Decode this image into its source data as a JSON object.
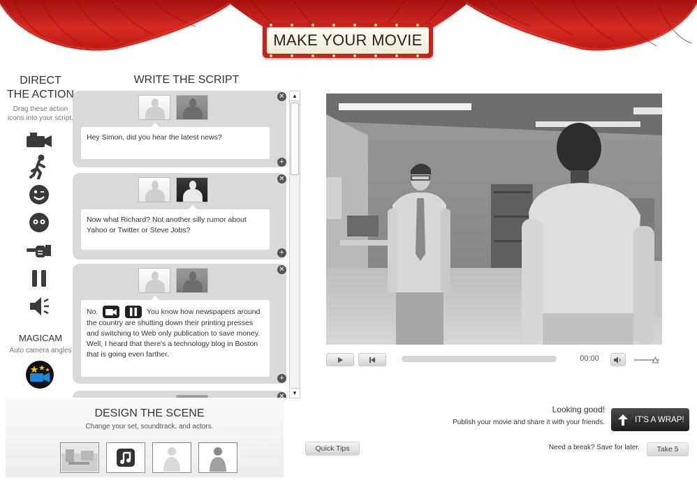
{
  "header": {
    "title": "MAKE YOUR MOVIE"
  },
  "direct": {
    "title_line1": "DIRECT",
    "title_line2": "THE ACTION",
    "subtitle_line1": "Drag these action",
    "subtitle_line2": "icons into your script.",
    "icons": [
      "camera-icon",
      "walk-icon",
      "smile-icon",
      "face-icon",
      "point-icon",
      "pause-icon",
      "sound-icon"
    ]
  },
  "magicam": {
    "title": "MAGICAM",
    "subtitle": "Auto camera angles"
  },
  "script": {
    "title": "WRITE THE SCRIPT",
    "lines": [
      {
        "text": "Hey Simon, did you hear the latest news?"
      },
      {
        "text": "Now what Richard? Not another silly rumor about Yahoo or Twitter or Steve Jobs?"
      },
      {
        "prefix": "No.",
        "text": "You know how newspapers around the country are shutting down their printing presses and switching to Web only publication to save money. Well, I heard that there's a technology blog in Boston that is going even farther."
      }
    ]
  },
  "scene": {
    "title": "DESIGN THE SCENE",
    "subtitle": "Change your set, soundtrack, and actors.",
    "thumbs": [
      "set-thumbnail",
      "soundtrack-thumbnail",
      "actor-1-thumbnail",
      "actor-2-thumbnail"
    ]
  },
  "player": {
    "time": "00:00",
    "progress": 0,
    "volume": 0.8
  },
  "tips": {
    "label": "Quick Tips"
  },
  "wrap": {
    "heading": "Looking good!",
    "description": "Publish your movie and share it with your friends.",
    "button_label": "IT'S A WRAP!"
  },
  "save": {
    "prompt": "Need a break? Save for later.",
    "button_label": "Take 5"
  },
  "colors": {
    "curtain": "#c8201c",
    "accent_dark": "#222222"
  }
}
